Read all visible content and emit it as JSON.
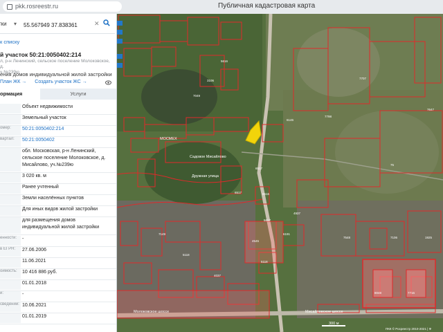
{
  "browser": {
    "url": "pkk.rosreestr.ru",
    "page_title": "Публичная кадастровая карта"
  },
  "search": {
    "mode": "тки",
    "query": "55.567949 37.838361"
  },
  "panel": {
    "back_link": "к списку",
    "title": "й участок 50:21:0050402:214",
    "address_short": "л, р-н Ленинский, сельское поселение Молоковское, д.\nч.№239ю",
    "purpose": "ения домов индивидуальной жилой застройки",
    "link_plan": "План ЖК →",
    "link_create": "Создать участок ЖС →",
    "tab_info": "ормация",
    "tab_services": "Услуги",
    "rows": [
      {
        "label": "",
        "value": "Объект недвижимости",
        "link": false
      },
      {
        "label": "",
        "value": "Земельный участок",
        "link": false
      },
      {
        "label": "омер:",
        "value": "50:21:0050402:214",
        "link": true
      },
      {
        "label": "вартал:",
        "value": "50:21:0050402",
        "link": true
      },
      {
        "label": "",
        "value": "обл. Московская, р-н Ленинский, сельское поселение Молоковское, д. Мисайлово, уч.№239ю",
        "link": false
      },
      {
        "label": "",
        "value": "3 020 кв. м",
        "link": false
      },
      {
        "label": "",
        "value": "Ранее учтенный",
        "link": false
      },
      {
        "label": "",
        "value": "Земли населённых пунктов",
        "link": false
      },
      {
        "label": "",
        "value": "Для иных видов жилой застройки",
        "link": false
      },
      {
        "label": "",
        "value": "для размещения домов индивидуальной жилой застройки",
        "link": false
      },
      {
        "label": "енности:",
        "value": "-",
        "link": false
      },
      {
        "label": "в ЕГРН:",
        "value": "27.06.2006",
        "link": false
      },
      {
        "label": "",
        "value": "11.06.2021",
        "link": false
      },
      {
        "label": "оимость:",
        "value": "10 416 886 руб.",
        "link": false
      },
      {
        "label": "",
        "value": "01.01.2018",
        "link": false
      },
      {
        "label": "и:",
        "value": "-",
        "link": false
      },
      {
        "label": "сведений:",
        "value": "10.06.2021",
        "link": false
      },
      {
        "label": "",
        "value": "01.01.2019",
        "link": false
      }
    ]
  },
  "map": {
    "labels": [
      "МОСМЕХ",
      "Садовое Мисайлово",
      "Дружная улица",
      "Молоковское шоссе",
      "Мисайловское шоссе",
      "300 м",
      "ПКК © Росреестр 2010-2021 | Ф"
    ],
    "parcel_numbers": [
      "7049",
      "3106",
      "5616",
      "6517",
      "6516",
      "5617",
      "75",
      "7647",
      "4937",
      "8048",
      "7716",
      "7548",
      "1925",
      "7106",
      "5118",
      "6146",
      "7707",
      "7798",
      "4545",
      "6191",
      "6517",
      "7149",
      "5118",
      "4037"
    ],
    "colors": {
      "parcel": "#e02a2a",
      "selected": "#f2d40a",
      "accent": "#2277c9"
    }
  }
}
